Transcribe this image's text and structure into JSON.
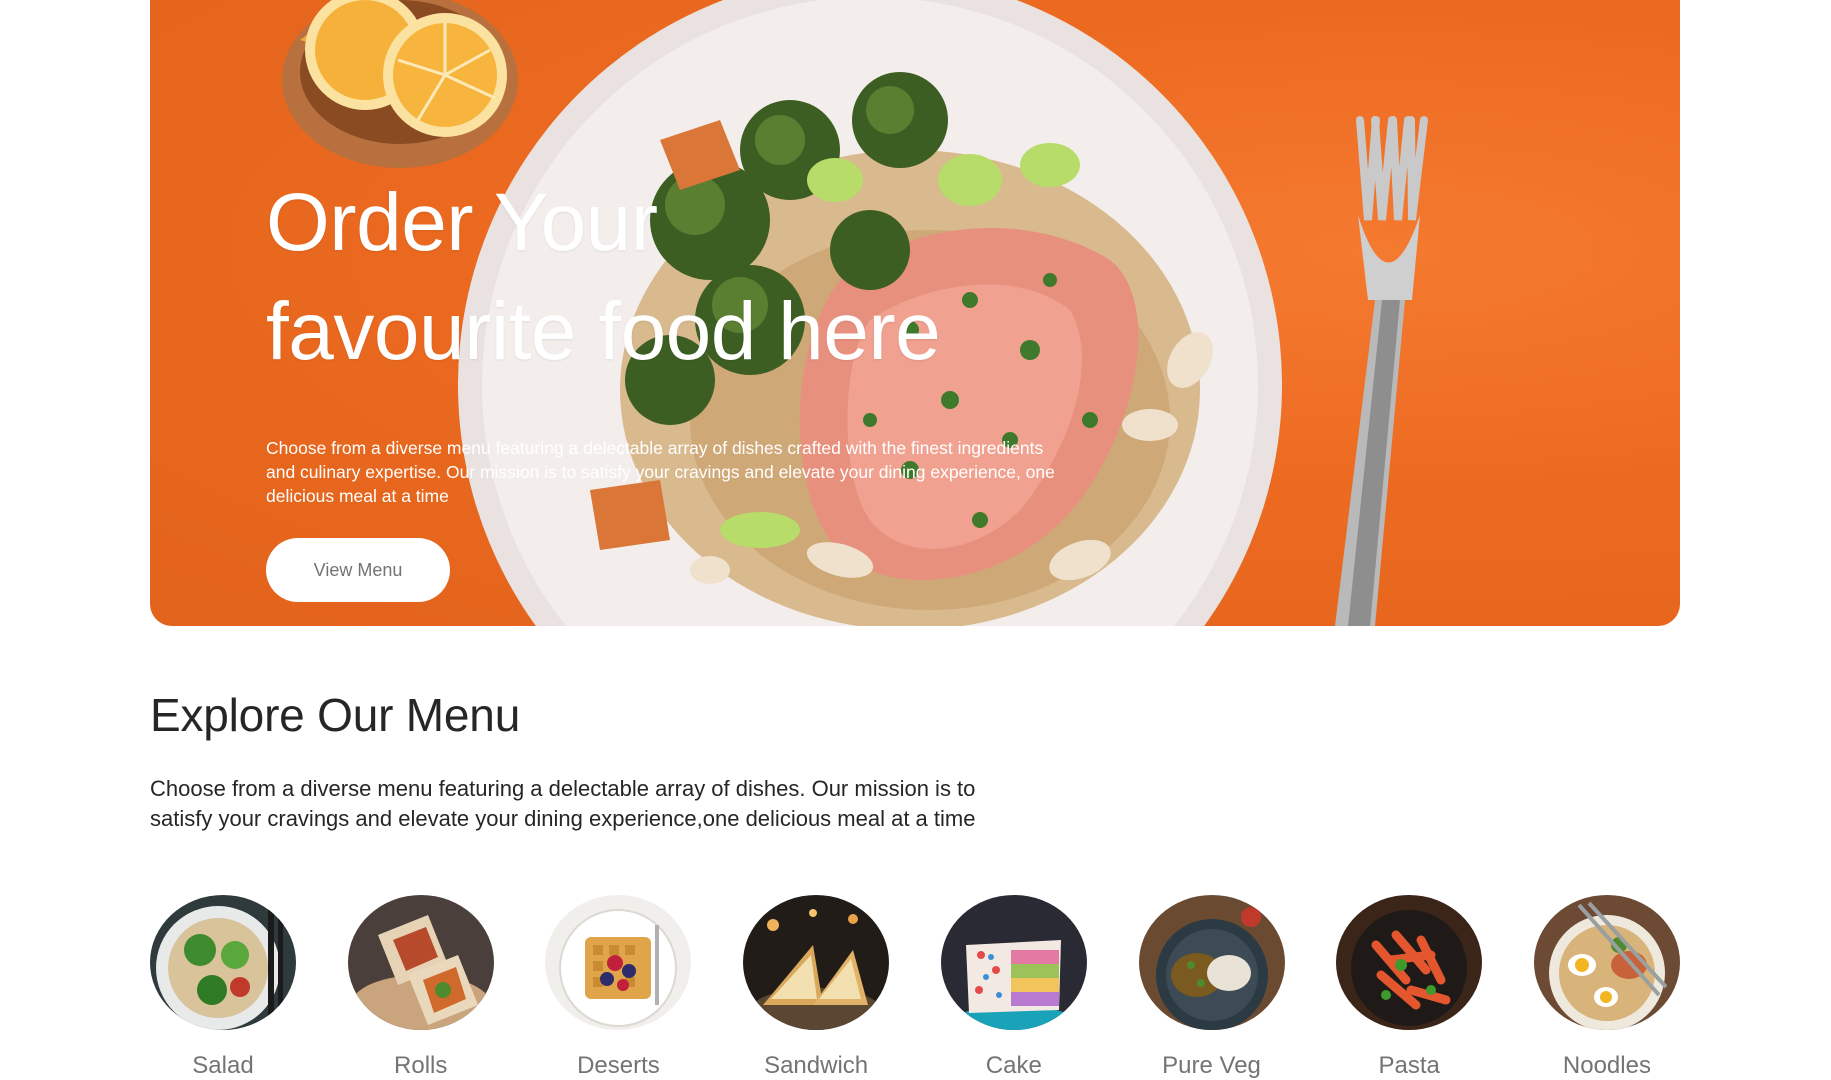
{
  "hero": {
    "title_line1": "Order Your",
    "title_line2": "favourite food here",
    "description": "Choose from a diverse menu featuring a delectable array of dishes crafted with the finest ingredients and culinary expertise. Our mission is to satisfy your cravings and elevate your dining experience, one delicious meal at a time",
    "button_label": "View Menu"
  },
  "explore": {
    "title": "Explore Our Menu",
    "description_line1": "Choose from a diverse menu featuring a delectable array of dishes. Our mission is to",
    "description_line2": "satisfy your cravings and elevate your dining experience,one delicious meal at a time"
  },
  "menu": {
    "items": [
      {
        "label": "Salad"
      },
      {
        "label": "Rolls"
      },
      {
        "label": "Deserts"
      },
      {
        "label": "Sandwich"
      },
      {
        "label": "Cake"
      },
      {
        "label": "Pure Veg"
      },
      {
        "label": "Pasta"
      },
      {
        "label": "Noodles"
      }
    ]
  },
  "colors": {
    "accent": "#ec6a20",
    "text": "#262626",
    "muted": "#747474"
  }
}
